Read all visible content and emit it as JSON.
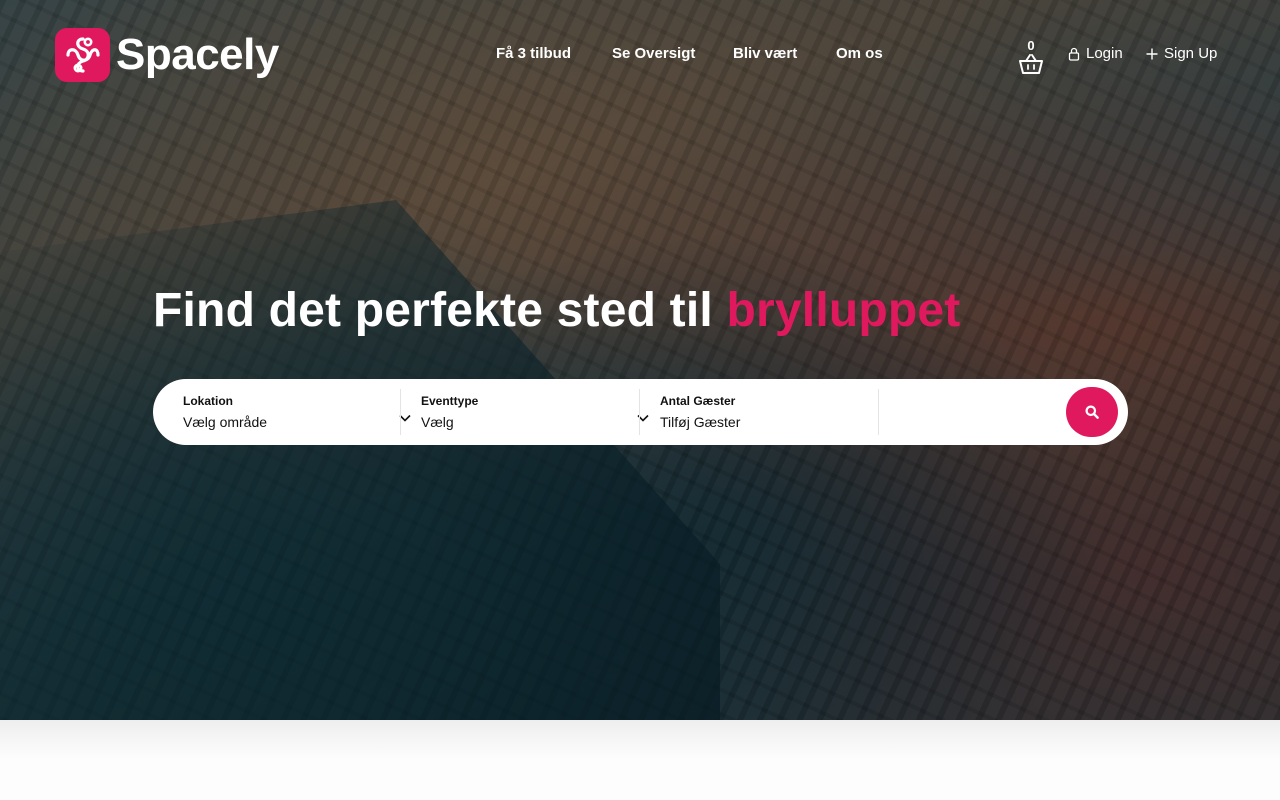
{
  "brand": {
    "name": "Spacely",
    "color": "#e0195e"
  },
  "nav": {
    "items": [
      {
        "label": "Få 3 tilbud"
      },
      {
        "label": "Se Oversigt"
      },
      {
        "label": "Bliv vært"
      },
      {
        "label": "Om os"
      }
    ]
  },
  "basket": {
    "count": "0",
    "icon": "basket-icon"
  },
  "auth": {
    "login_label": "Login",
    "signup_label": "Sign Up"
  },
  "hero": {
    "headline_prefix": "Find det perfekte sted til ",
    "headline_accent": "brylluppet"
  },
  "search": {
    "location": {
      "label": "Lokation",
      "value": "Vælg område"
    },
    "event_type": {
      "label": "Eventtype",
      "value": "Vælg"
    },
    "guests": {
      "label": "Antal Gæster",
      "placeholder": "Tilføj Gæster"
    },
    "button_icon": "search-icon"
  }
}
